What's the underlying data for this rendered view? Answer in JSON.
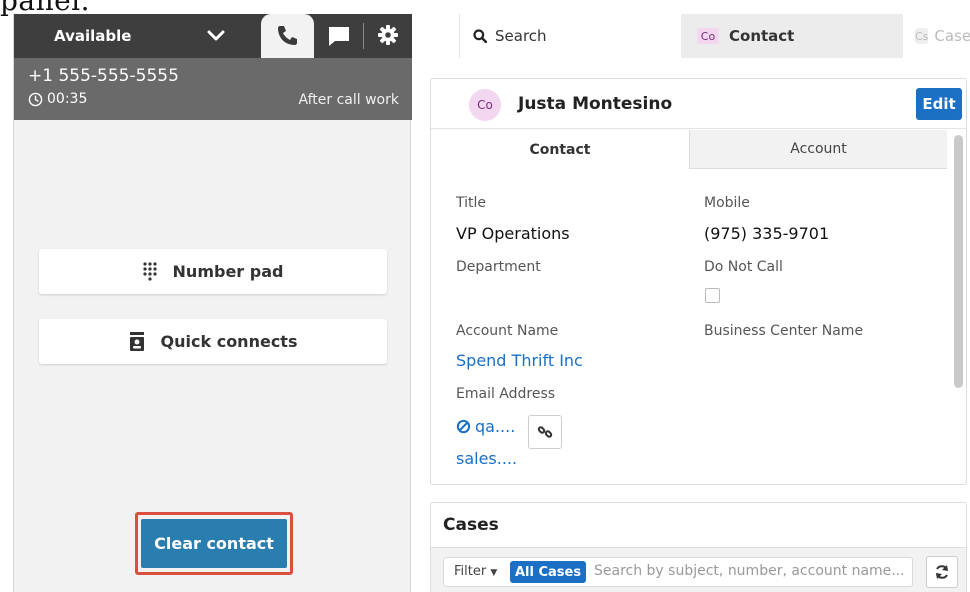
{
  "doc_fragment": "panel.",
  "ccp": {
    "status": "Available",
    "call": {
      "number": "+1 555-555-5555",
      "timer": "00:35",
      "state": "After call work"
    },
    "buttons": {
      "number_pad": "Number pad",
      "quick_connects": "Quick connects",
      "clear_contact": "Clear contact"
    }
  },
  "crm": {
    "tabs": {
      "search": "Search",
      "contact_badge": "Co",
      "contact": "Contact",
      "case_badge": "Cs",
      "case": "Case"
    },
    "contact": {
      "avatar": "Co",
      "name": "Justa Montesino",
      "edit": "Edit",
      "subtabs": [
        "Contact",
        "Account"
      ],
      "fields": {
        "title_label": "Title",
        "title_value": "VP Operations",
        "mobile_label": "Mobile",
        "mobile_value": "(975) 335-9701",
        "department_label": "Department",
        "do_not_call_label": "Do Not Call",
        "account_name_label": "Account Name",
        "account_name_value": "Spend Thrift Inc",
        "business_center_label": "Business Center Name",
        "email_label": "Email Address",
        "email_1": "qa....",
        "email_2": "sales...."
      }
    },
    "cases": {
      "title": "Cases",
      "filter": "Filter",
      "filter_value": "All Cases",
      "search_placeholder": "Search by subject, number, account name..."
    }
  },
  "colors": {
    "ccp_header": "#3e3e3e",
    "call_info": "#6a6a6a",
    "clear_button": "#2a7eaf",
    "highlight_frame": "#d9503f",
    "link_blue": "#1b6fc4"
  }
}
